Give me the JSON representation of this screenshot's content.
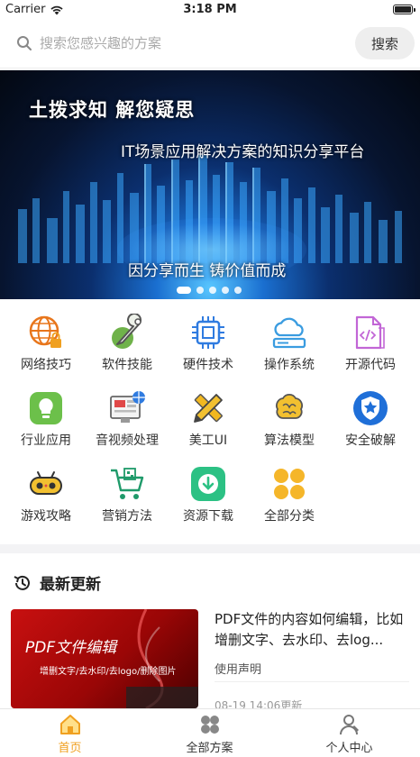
{
  "status_bar": {
    "carrier": "Carrier",
    "time": "3:18 PM"
  },
  "search": {
    "placeholder": "搜索您感兴趣的方案",
    "button_label": "搜索"
  },
  "banner": {
    "title": "土拨求知 解您疑思",
    "subtitle": "IT场景应用解决方案的知识分享平台",
    "slogan": "因分享而生 铸价值而成",
    "slide_count": 5,
    "active_slide": 1
  },
  "categories": [
    {
      "label": "网络技巧",
      "icon": "network-globe-icon"
    },
    {
      "label": "软件技能",
      "icon": "wrench-icon"
    },
    {
      "label": "硬件技术",
      "icon": "chip-icon"
    },
    {
      "label": "操作系统",
      "icon": "cloud-server-icon"
    },
    {
      "label": "开源代码",
      "icon": "code-file-icon"
    },
    {
      "label": "行业应用",
      "icon": "lightbulb-icon"
    },
    {
      "label": "音视频处理",
      "icon": "monitor-media-icon"
    },
    {
      "label": "美工UI",
      "icon": "pencil-ruler-icon"
    },
    {
      "label": "算法模型",
      "icon": "brain-icon"
    },
    {
      "label": "安全破解",
      "icon": "shield-star-icon"
    },
    {
      "label": "游戏攻略",
      "icon": "gamepad-icon"
    },
    {
      "label": "营销方法",
      "icon": "shopping-cart-icon"
    },
    {
      "label": "资源下载",
      "icon": "download-icon"
    },
    {
      "label": "全部分类",
      "icon": "four-dots-icon"
    }
  ],
  "latest": {
    "title": "最新更新",
    "articles": [
      {
        "thumb_title": "PDF文件编辑",
        "thumb_subtitle": "增删文字/去水印/去logo/删除图片",
        "title": "PDF文件的内容如何编辑，比如增删文字、去水印、去log...",
        "tag": "使用声明",
        "time": "08-19 14:06更新"
      }
    ]
  },
  "tabbar": {
    "items": [
      {
        "label": "首页",
        "icon": "home-icon",
        "active": true
      },
      {
        "label": "全部方案",
        "icon": "grid-circles-icon",
        "active": false
      },
      {
        "label": "个人中心",
        "icon": "user-icon",
        "active": false
      }
    ]
  },
  "colors": {
    "accent": "#f0a020",
    "search_button_bg": "#eeeeee",
    "section_bg": "#f3f3f5"
  }
}
